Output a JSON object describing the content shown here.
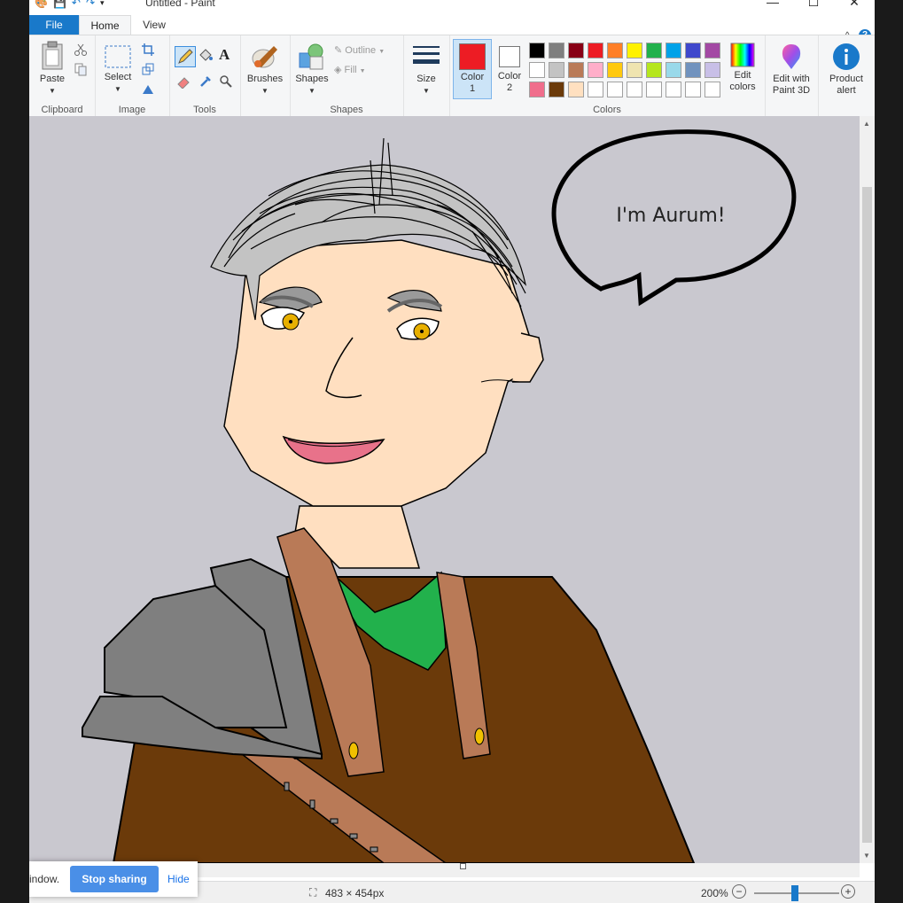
{
  "window": {
    "title": "Untitled - Paint",
    "minimize_glyph": "—",
    "maximize_glyph": "☐",
    "close_glyph": "✕"
  },
  "tabs": [
    {
      "label": "File"
    },
    {
      "label": "Home"
    },
    {
      "label": "View"
    }
  ],
  "ribbon": {
    "collapse_glyph": "^",
    "help_glyph": "?",
    "groups": {
      "clipboard": {
        "label": "Clipboard",
        "paste": "Paste"
      },
      "image": {
        "label": "Image",
        "select": "Select"
      },
      "tools": {
        "label": "Tools"
      },
      "brushes": {
        "label": "Brushes"
      },
      "shapes": {
        "label": "Shapes",
        "shapes_btn": "Shapes",
        "outline": "Outline",
        "fill": "Fill"
      },
      "size": {
        "label": "Size"
      },
      "colors": {
        "label": "Colors",
        "color1": "Color 1",
        "color1_line1": "Color",
        "color1_line2": "1",
        "color2_line1": "Color",
        "color2_line2": "2",
        "color1_value": "#ed1c24",
        "color2_value": "#ffffff",
        "edit_line1": "Edit",
        "edit_line2": "colors",
        "palette_row1": [
          "#000000",
          "#7f7f7f",
          "#880015",
          "#ed1c24",
          "#ff7f27",
          "#fff200",
          "#22b14c",
          "#00a2e8",
          "#3f48cc",
          "#a349a4"
        ],
        "palette_row2": [
          "#ffffff",
          "#c3c3c3",
          "#b97a57",
          "#ffaec9",
          "#ffc90e",
          "#efe4b0",
          "#b5e61d",
          "#99d9ea",
          "#7092be",
          "#c8bfe7"
        ],
        "palette_row3": [
          "#f06e8c",
          "#6b3a0a",
          "#ffe0c0",
          "#ffffff",
          "#ffffff",
          "#ffffff",
          "#ffffff",
          "#ffffff",
          "#ffffff",
          "#ffffff"
        ]
      },
      "paint3d": {
        "line1": "Edit with",
        "line2": "Paint 3D"
      },
      "product_alert": {
        "line1": "Product",
        "line2": "alert"
      }
    }
  },
  "canvas": {
    "speech_text": "I'm Aurum!"
  },
  "status": {
    "dimensions": "483 × 454px",
    "zoom": "200%",
    "zoom_fraction": 0.48
  },
  "share_bar": {
    "text": "indow.",
    "stop_label": "Stop sharing",
    "hide_label": "Hide"
  }
}
